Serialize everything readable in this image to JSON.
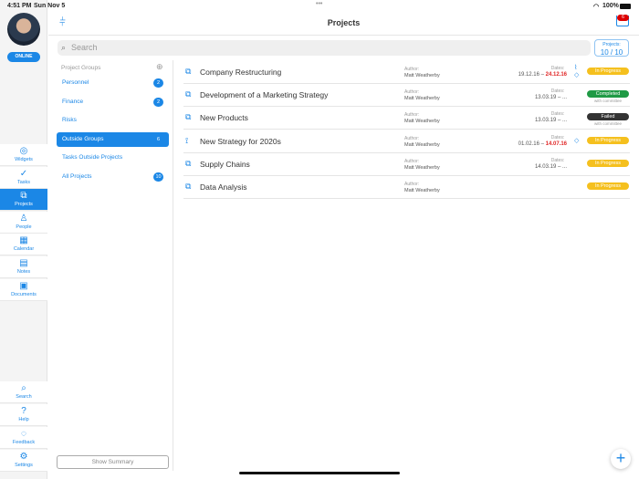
{
  "status": {
    "time": "4:51 PM",
    "date": "Sun Nov 5",
    "battery": "100%"
  },
  "user": {
    "status": "ONLINE"
  },
  "nav": [
    {
      "label": "Widgets",
      "icon": "◎"
    },
    {
      "label": "Tasks",
      "icon": "✓"
    },
    {
      "label": "Projects",
      "icon": "⧉"
    },
    {
      "label": "People",
      "icon": "♙"
    },
    {
      "label": "Calendar",
      "icon": "▦"
    },
    {
      "label": "Notes",
      "icon": "▤"
    },
    {
      "label": "Documents",
      "icon": "▣"
    }
  ],
  "nav_bottom": [
    {
      "label": "Search",
      "icon": "⌕"
    },
    {
      "label": "Help",
      "icon": "?"
    },
    {
      "label": "Feedback",
      "icon": "◌"
    },
    {
      "label": "Settings",
      "icon": "⚙"
    }
  ],
  "header": {
    "title": "Projects",
    "inbox_count": "6"
  },
  "search": {
    "placeholder": "Search"
  },
  "projects_counter": {
    "label": "Projects:",
    "value": "10 / 10"
  },
  "groups": {
    "header": "Project Groups",
    "items": [
      {
        "label": "Personnel",
        "count": "2"
      },
      {
        "label": "Finance",
        "count": "2"
      },
      {
        "label": "Risks",
        "count": null
      },
      {
        "label": "Outside Groups",
        "count": "6"
      },
      {
        "label": "Tasks Outside Projects",
        "count": null
      },
      {
        "label": "All Projects",
        "count": "10"
      }
    ],
    "show_summary": "Show Summary"
  },
  "projects": [
    {
      "name": "Company Restructuring",
      "icon": "briefcase",
      "author_label": "Author:",
      "author": "Matt Weatherby",
      "dates_label": "Dates:",
      "start": "19.12.16 – ",
      "end": "24.12.16",
      "status": "In Progress",
      "color": "#f5c01e",
      "sub": ""
    },
    {
      "name": "Development of a Marketing Strategy",
      "icon": "briefcase",
      "author_label": "Author:",
      "author": "Matt Weatherby",
      "dates_label": "Dates:",
      "start": "13.03.19 – ...",
      "end": "",
      "status": "Completed",
      "color": "#1f9a45",
      "sub": "with committee"
    },
    {
      "name": "New Products",
      "icon": "briefcase",
      "author_label": "Author:",
      "author": "Matt Weatherby",
      "dates_label": "Dates:",
      "start": "13.03.19 – ...",
      "end": "",
      "status": "Failed",
      "color": "#333333",
      "sub": "with committee"
    },
    {
      "name": "New Strategy for 2020s",
      "icon": "rss",
      "author_label": "Author:",
      "author": "Matt Weatherby",
      "dates_label": "Dates:",
      "start": "01.02.16 – ",
      "end": "14.07.16",
      "status": "In Progress",
      "color": "#f5c01e",
      "sub": ""
    },
    {
      "name": "Supply Chains",
      "icon": "briefcase",
      "author_label": "Author:",
      "author": "Matt Weatherby",
      "dates_label": "Dates:",
      "start": "14.03.19 – ...",
      "end": "",
      "status": "In Progress",
      "color": "#f5c01e",
      "sub": ""
    },
    {
      "name": "Data Analysis",
      "icon": "briefcase",
      "author_label": "Author:",
      "author": "Matt Weatherby",
      "dates_label": "",
      "start": "",
      "end": "",
      "status": "In Progress",
      "color": "#f5c01e",
      "sub": ""
    }
  ]
}
